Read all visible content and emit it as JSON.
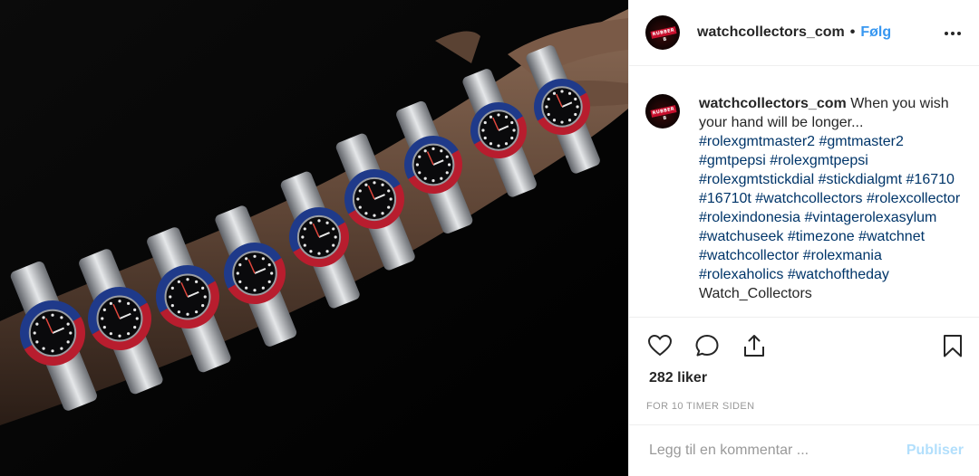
{
  "post": {
    "username": "watchcollectors_com",
    "separator": "•",
    "follow_label": "Følg",
    "avatar_text": "RUBBER B"
  },
  "caption": {
    "username": "watchcollectors_com",
    "text": "When you wish your hand will be longer...",
    "hashtags": "#rolexgmtmaster2 #gmtmaster2 #gmtpepsi #rolexgmtpepsi #rolexgmtstickdial #stickdialgmt #16710 #16710t #watchcollectors #rolexcollector #rolexindonesia #vintagerolexasylum #watchuseek #timezone #watchnet #watchcollector #rolexmania #rolexaholics #watchoftheday",
    "trailing": "Watch_Collectors"
  },
  "stats": {
    "likes": "282 liker",
    "time": "FOR 10 TIMER SIDEN"
  },
  "comment_box": {
    "placeholder": "Legg til en kommentar ...",
    "publish_label": "Publiser"
  },
  "icons": [
    "heart-icon",
    "comment-icon",
    "share-icon",
    "bookmark-icon",
    "more-icon"
  ],
  "colors": {
    "link": "#003569",
    "follow": "#3897f0",
    "publish_disabled": "#b2dffc",
    "bezel_red": "#b81d2e",
    "bezel_blue": "#1f3a8a"
  }
}
